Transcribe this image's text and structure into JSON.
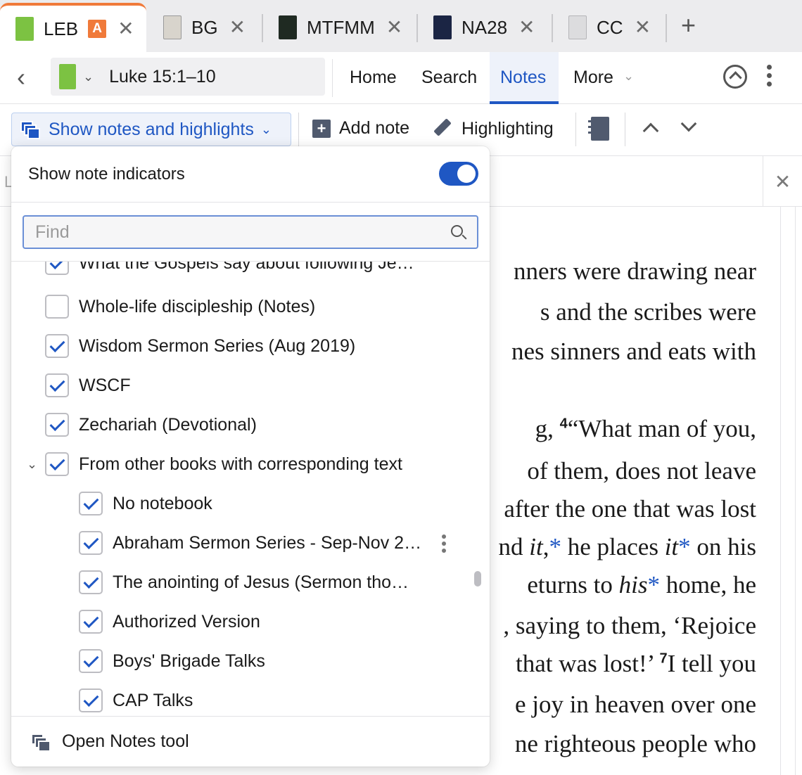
{
  "tabs": [
    {
      "label": "LEB",
      "badge": "A",
      "close": "✕"
    },
    {
      "label": "BG",
      "close": "✕"
    },
    {
      "label": "MTFMM",
      "close": "✕"
    },
    {
      "label": "NA28",
      "close": "✕"
    },
    {
      "label": "CC",
      "close": "✕"
    }
  ],
  "new_tab": "+",
  "nav": {
    "back": "‹",
    "reference": "Luke 15:1–10",
    "links": {
      "home": "Home",
      "search": "Search",
      "notes": "Notes",
      "more": "More"
    }
  },
  "toolbar": {
    "show_notes": "Show notes and highlights",
    "add_note": "Add note",
    "highlighting": "Highlighting"
  },
  "pane": {
    "left_char": "L",
    "close": "✕"
  },
  "reading": [
    {
      "text": "nners were drawing near"
    },
    {
      "text": "s and the scribes were"
    },
    {
      "text": "nes sinners and eats with"
    },
    {
      "pre": "g, ",
      "verse": "4",
      "post": "“What man of you,"
    },
    {
      "text": "of them, does not leave"
    },
    {
      "text": "after the one that was lost"
    },
    {
      "text": "nd it,* he places it* on his"
    },
    {
      "text": "eturns to his* home, he"
    },
    {
      "text": ", saying to them, ‘Rejoice"
    },
    {
      "pre": "that was lost!’ ",
      "verse": "7",
      "post": "I tell you"
    },
    {
      "text": "e joy in heaven over one"
    },
    {
      "text": "ne righteous people who"
    }
  ],
  "dropdown": {
    "show_indicators_label": "Show note indicators",
    "show_indicators_on": true,
    "find_placeholder": "Find",
    "items": [
      {
        "label": "What the Gospels say about following Je…",
        "checked": true,
        "level": 0
      },
      {
        "label": "Whole-life discipleship (Notes)",
        "checked": false,
        "level": 0
      },
      {
        "label": "Wisdom Sermon Series (Aug 2019)",
        "checked": true,
        "level": 0
      },
      {
        "label": "WSCF",
        "checked": true,
        "level": 0
      },
      {
        "label": "Zechariah (Devotional)",
        "checked": true,
        "level": 0
      },
      {
        "label": "From other books with corresponding text",
        "checked": true,
        "level": 0,
        "expanded": true
      },
      {
        "label": "No notebook",
        "checked": true,
        "level": 1
      },
      {
        "label": "Abraham Sermon Series - Sep-Nov 2…",
        "checked": true,
        "level": 1,
        "has_menu": true
      },
      {
        "label": "The anointing of Jesus (Sermon tho…",
        "checked": true,
        "level": 1
      },
      {
        "label": "Authorized Version",
        "checked": true,
        "level": 1
      },
      {
        "label": "Boys' Brigade Talks",
        "checked": true,
        "level": 1
      },
      {
        "label": "CAP Talks",
        "checked": true,
        "level": 1
      }
    ],
    "footer": "Open Notes tool"
  },
  "colors": {
    "accent": "#1f57c3",
    "tab_active": "#f07a3a",
    "leb_green": "#7cc242"
  }
}
